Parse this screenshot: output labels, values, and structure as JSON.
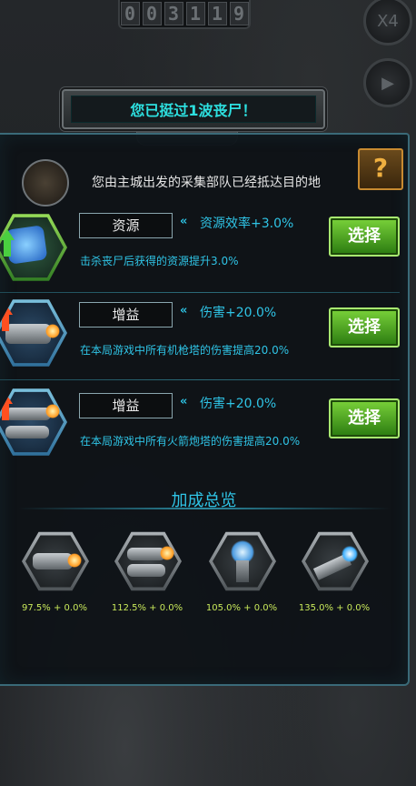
{
  "hud": {
    "score_digits": [
      "0",
      "0",
      "3",
      "1",
      "1",
      "9"
    ],
    "speed_label": "X4",
    "play_icon": "play-icon"
  },
  "banner": {
    "wave_text": "您已挺过1波丧尸！"
  },
  "message": {
    "text": "您由主城出发的采集部队已经抵达目的地",
    "help_label": "?"
  },
  "options": [
    {
      "category": "资源",
      "effect": "资源效率+3.0%",
      "description": "击杀丧尸后获得的资源提升3.0%",
      "button": "选择",
      "icon": "resource-crystal-icon"
    },
    {
      "category": "增益",
      "effect": "伤害+20.0%",
      "description": "在本局游戏中所有机枪塔的伤害提高20.0%",
      "button": "选择",
      "icon": "machine-gun-tower-icon"
    },
    {
      "category": "增益",
      "effect": "伤害+20.0%",
      "description": "在本局游戏中所有火箭炮塔的伤害提高20.0%",
      "button": "选择",
      "icon": "rocket-tower-icon"
    }
  ],
  "summary": {
    "title": "加成总览",
    "items": [
      {
        "icon": "machine-gun-tower-icon",
        "value": "97.5% + 0.0%"
      },
      {
        "icon": "rocket-tower-icon",
        "value": "112.5% + 0.0%"
      },
      {
        "icon": "tesla-tower-icon",
        "value": "105.0% + 0.0%"
      },
      {
        "icon": "laser-tower-icon",
        "value": "135.0% + 0.0%"
      }
    ]
  },
  "colors": {
    "accent_cyan": "#2fc4e6",
    "button_green": "#5cb82a",
    "summary_value": "#c8e85a"
  }
}
